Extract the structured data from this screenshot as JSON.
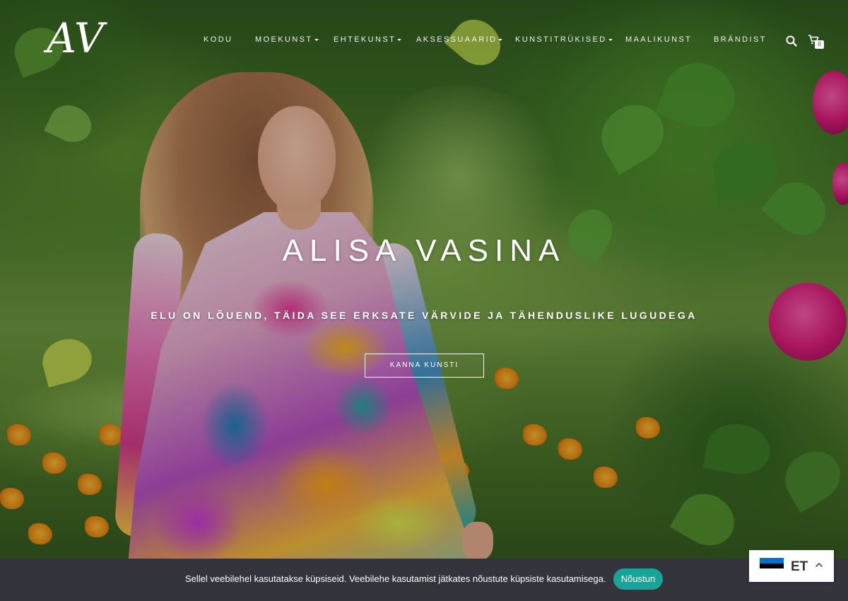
{
  "header": {
    "logo_text": "AV",
    "nav": [
      {
        "label": "KODU",
        "has_dropdown": false
      },
      {
        "label": "MOEKUNST",
        "has_dropdown": true
      },
      {
        "label": "EHTEKUNST",
        "has_dropdown": true
      },
      {
        "label": "AKSESSUAARID",
        "has_dropdown": true
      },
      {
        "label": "KUNSTITRÜKISED",
        "has_dropdown": true
      },
      {
        "label": "MAALIKUNST",
        "has_dropdown": false
      },
      {
        "label": "BRÄNDIST",
        "has_dropdown": false
      }
    ],
    "search_icon": "search-icon",
    "cart_icon": "cart-icon",
    "cart_count": "0"
  },
  "hero": {
    "title": "ALISA VASINA",
    "subtitle": "ELU ON LÕUEND, TÄIDA SEE ERKSATE VÄRVIDE JA TÄHENDUSLIKE LUGUDEGA",
    "button_label": "KANNA KUNSTI"
  },
  "cookie_bar": {
    "text": "Sellel veebilehel kasutatakse küpsiseid. Veebilehe kasutamist jätkates nõustute küpsiste kasutamisega.",
    "accept_label": "Nõustun",
    "accept_color": "#17a59a",
    "background": "#34343c"
  },
  "language_switcher": {
    "code": "ET",
    "flag_colors": [
      "#0072ce",
      "#000000",
      "#ffffff"
    ],
    "chevron_icon": "chevron-up-icon"
  }
}
